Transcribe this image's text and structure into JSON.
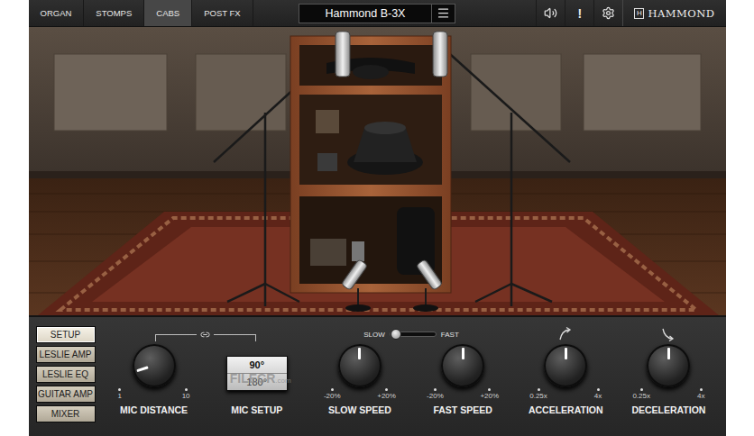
{
  "tabs": [
    {
      "label": "ORGAN",
      "selected": false
    },
    {
      "label": "STOMPS",
      "selected": false
    },
    {
      "label": "CABS",
      "selected": true
    },
    {
      "label": "POST FX",
      "selected": false
    }
  ],
  "preset": {
    "name": "Hammond B-3X"
  },
  "toolbar": {
    "alert": "!"
  },
  "logo": {
    "mark": "H",
    "text": "HAMMOND"
  },
  "sections": [
    {
      "label": "SETUP",
      "selected": true
    },
    {
      "label": "LESLIE AMP",
      "selected": false
    },
    {
      "label": "LESLIE EQ",
      "selected": false
    },
    {
      "label": "GUITAR AMP",
      "selected": false
    },
    {
      "label": "MIXER",
      "selected": false
    }
  ],
  "speed_switch": {
    "options": [
      {
        "label": "SLOW",
        "selected": true
      },
      {
        "label": "FAST",
        "selected": false
      }
    ]
  },
  "controls": [
    {
      "kind": "knob",
      "label": "MIC DISTANCE",
      "level": 0.1,
      "min": "1",
      "max": "10"
    },
    {
      "kind": "toggle",
      "label": "MIC SETUP",
      "options": [
        {
          "label": "90°",
          "selected": true
        },
        {
          "label": "180°",
          "selected": false
        }
      ]
    },
    {
      "kind": "knob",
      "label": "SLOW SPEED",
      "level": 0.5,
      "min": "-20%",
      "max": "+20%"
    },
    {
      "kind": "knob",
      "label": "FAST SPEED",
      "level": 0.5,
      "min": "-20%",
      "max": "+20%"
    },
    {
      "kind": "knob",
      "label": "ACCELERATION",
      "level": 0.5,
      "min": "0.25x",
      "max": "4x"
    },
    {
      "kind": "knob",
      "label": "DECELERATION",
      "level": 0.5,
      "min": "0.25x",
      "max": "4x"
    }
  ],
  "watermark": {
    "text": "FILECR",
    "suffix": ".com"
  }
}
